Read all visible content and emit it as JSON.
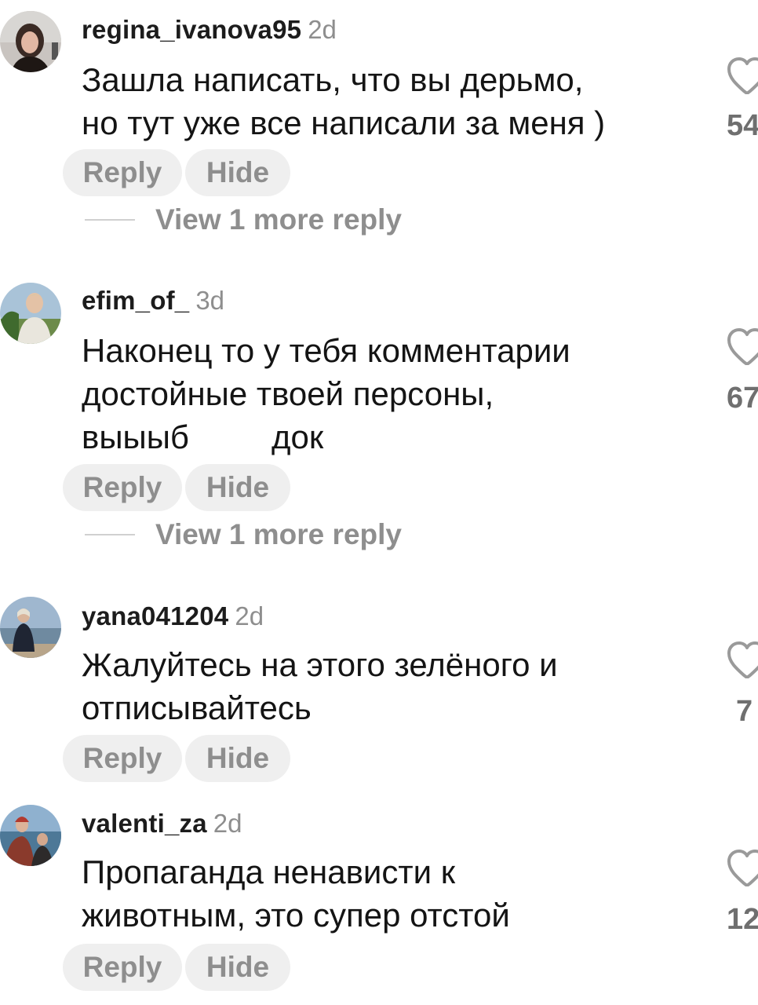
{
  "comments": [
    {
      "username": "regina_ivanova95",
      "time": "2d",
      "text": "Зашла написать, что вы дерьмо,\nно тут уже все написали за меня )",
      "likes": "54",
      "reply_label": "Reply",
      "hide_label": "Hide",
      "view_more": "View 1 more reply"
    },
    {
      "username": "efim_of_",
      "time": "3d",
      "text": "Наконец то у тебя комментарии\nдостойные твоей персоны,\nвыыыб         док",
      "likes": "67",
      "reply_label": "Reply",
      "hide_label": "Hide",
      "view_more": "View 1 more reply"
    },
    {
      "username": "yana041204",
      "time": "2d",
      "text": "Жалуйтесь на этого зелёного и\nотписывайтесь",
      "likes": "7",
      "reply_label": "Reply",
      "hide_label": "Hide"
    },
    {
      "username": "valenti_za",
      "time": "2d",
      "text": "Пропаганда ненависти к\nживотным, это супер отстой",
      "likes": "12",
      "reply_label": "Reply",
      "hide_label": "Hide"
    }
  ],
  "icons": {
    "like": "heart-outline-icon"
  },
  "colors": {
    "muted": "#8e8e8e",
    "pill_bg": "#efefef"
  }
}
